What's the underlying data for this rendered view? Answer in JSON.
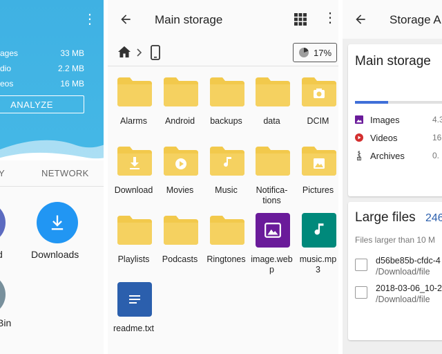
{
  "left": {
    "stats": [
      {
        "label": "ages",
        "value": "33 MB"
      },
      {
        "label": "dio",
        "value": "2.2 MB"
      },
      {
        "label": "eos",
        "value": "16 MB"
      }
    ],
    "analyze_label": "ANALYZE",
    "tabs": [
      "Y",
      "NETWORK"
    ],
    "items": [
      {
        "label": "d"
      },
      {
        "label": "Downloads"
      },
      {
        "label": "Bin"
      }
    ]
  },
  "middle": {
    "title": "Main storage",
    "storage_percent": "17%",
    "files": [
      {
        "name": "Alarms",
        "type": "folder"
      },
      {
        "name": "Android",
        "type": "folder"
      },
      {
        "name": "backups",
        "type": "folder"
      },
      {
        "name": "data",
        "type": "folder"
      },
      {
        "name": "DCIM",
        "type": "folder-camera"
      },
      {
        "name": "Download",
        "type": "folder-download"
      },
      {
        "name": "Movies",
        "type": "folder-movie"
      },
      {
        "name": "Music",
        "type": "folder-music"
      },
      {
        "name": "Notifica-\ntions",
        "type": "folder"
      },
      {
        "name": "Pictures",
        "type": "folder-picture"
      },
      {
        "name": "Playlists",
        "type": "folder"
      },
      {
        "name": "Podcasts",
        "type": "folder"
      },
      {
        "name": "Ringtones",
        "type": "folder"
      },
      {
        "name": "image.web\np",
        "type": "image-file"
      },
      {
        "name": "music.mp\n3",
        "type": "music-file"
      },
      {
        "name": "readme.txt",
        "type": "text-file"
      }
    ]
  },
  "right": {
    "title": "Storage A",
    "storage_card": {
      "title": "Main storage",
      "rows": [
        {
          "label": "Images",
          "value": "4.3"
        },
        {
          "label": "Videos",
          "value": "16"
        },
        {
          "label": "Archives",
          "value": "0."
        }
      ]
    },
    "large_files": {
      "title": "Large files",
      "count": "246",
      "subtitle": "Files larger than 10 M",
      "files": [
        {
          "name": "d56be85b-cfdc-4",
          "path": "/Download/file"
        },
        {
          "name": "2018-03-06_10-2",
          "path": "/Download/file"
        }
      ]
    }
  },
  "colors": {
    "accent_blue": "#3fb1e3",
    "folder_yellow": "#f2c94c",
    "download_blue": "#2196f3",
    "image_purple": "#6a1b9a",
    "music_teal": "#00897b",
    "text_blue": "#2b5fad"
  }
}
